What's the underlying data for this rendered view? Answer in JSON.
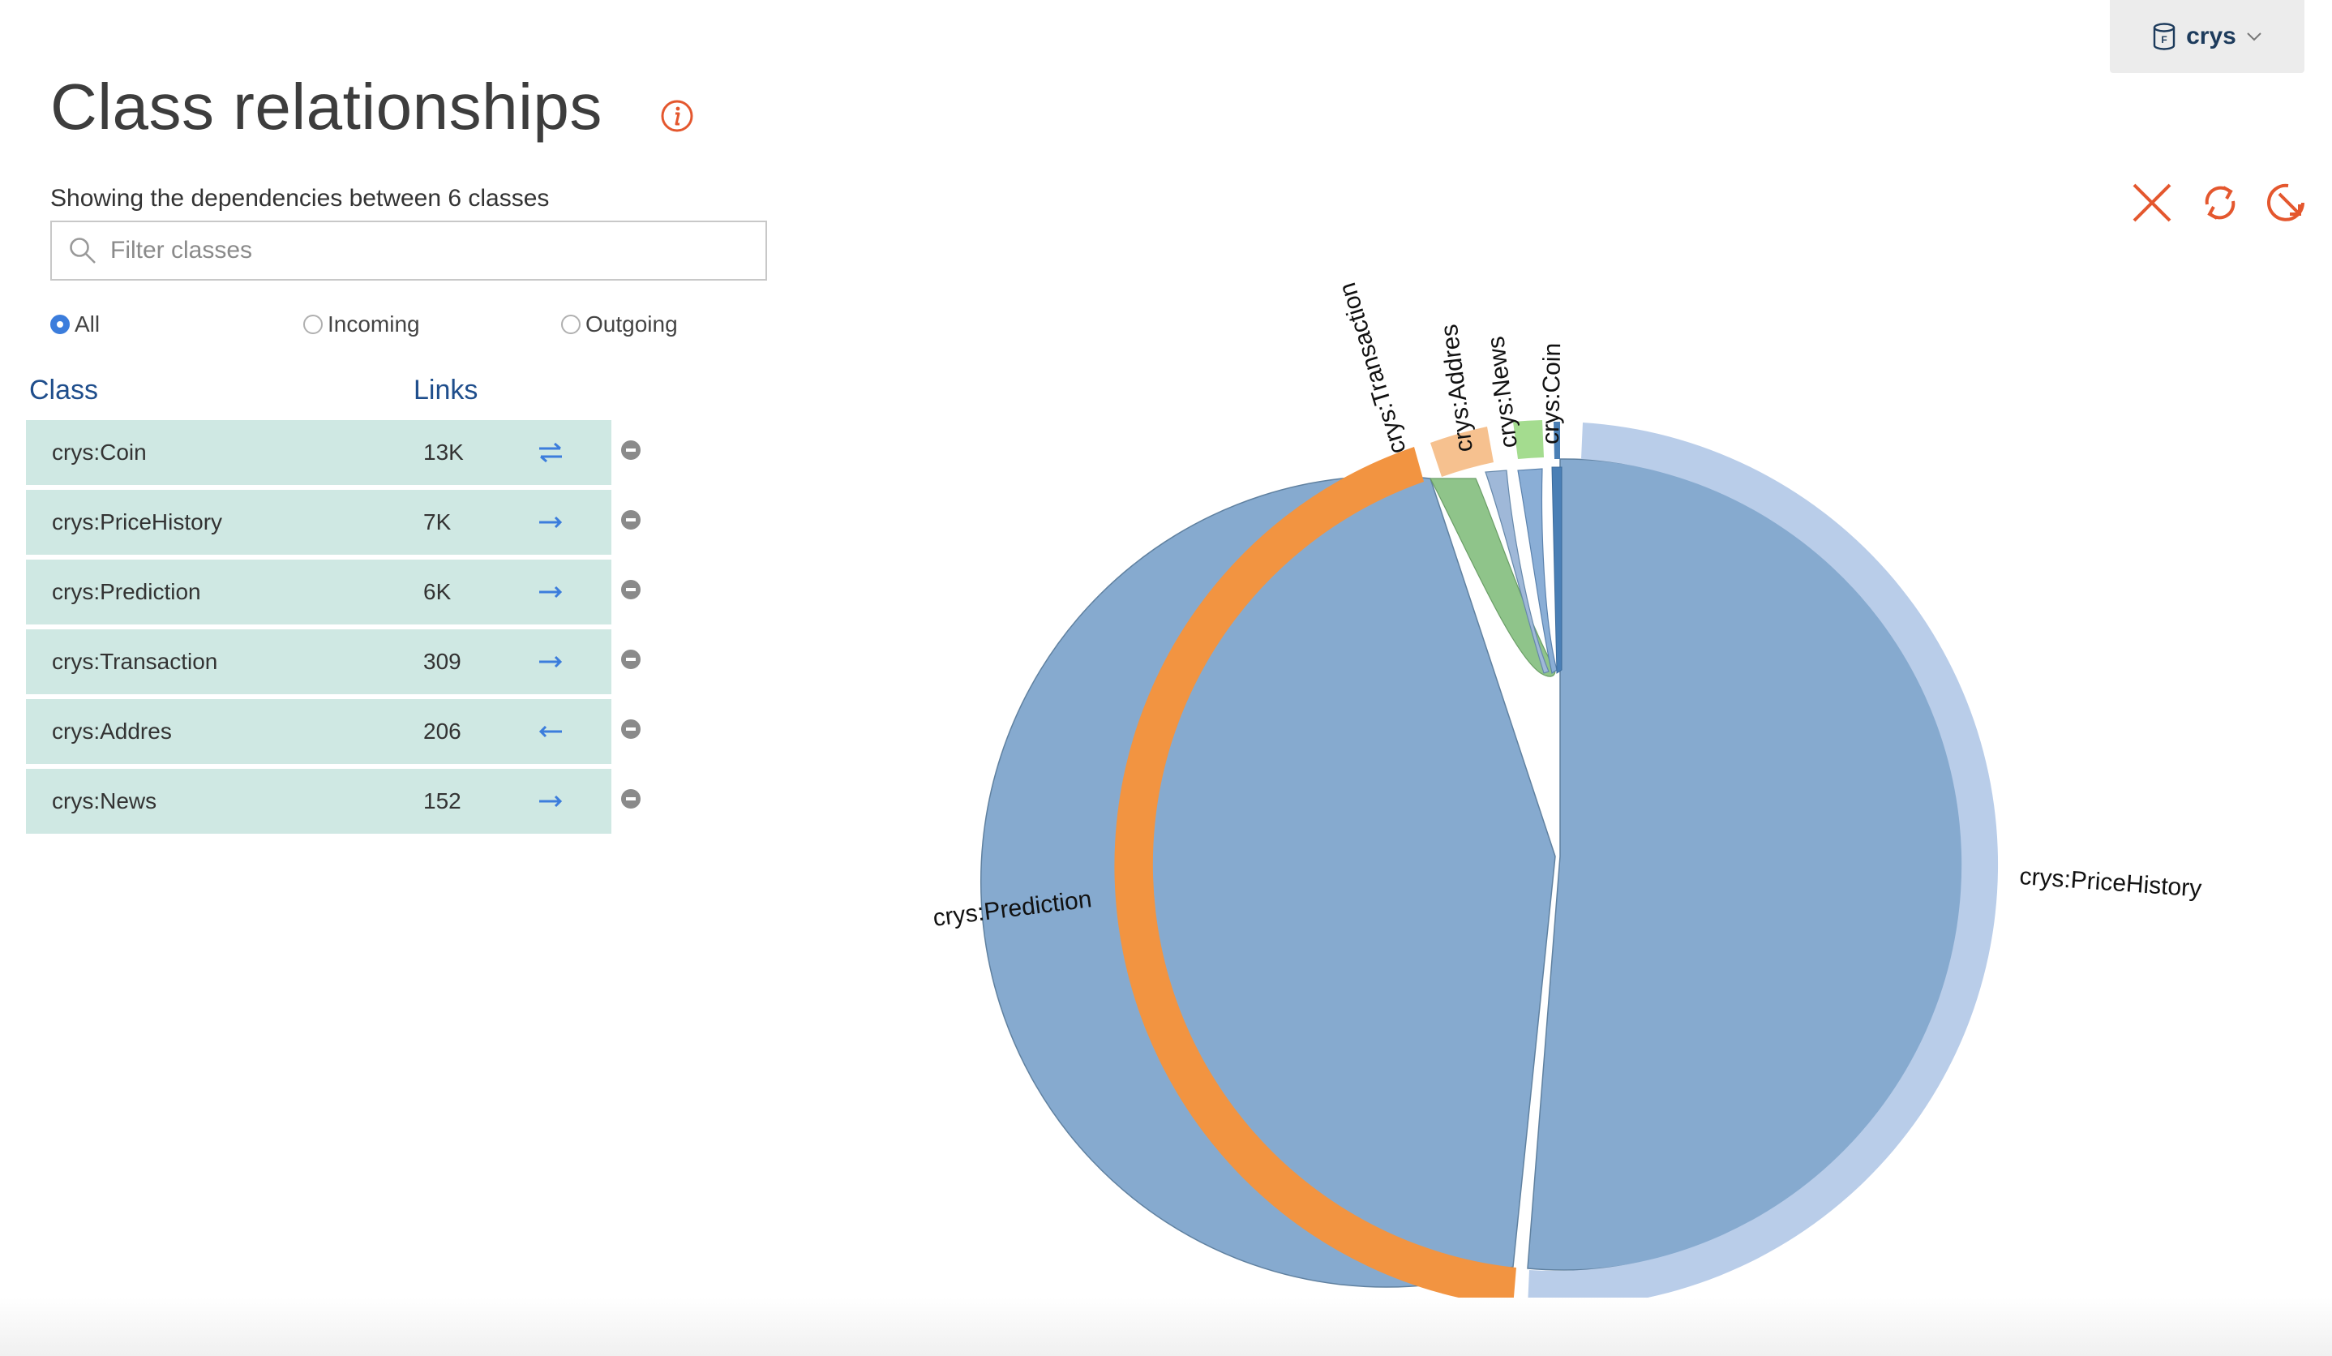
{
  "repository": {
    "name": "crys"
  },
  "header": {
    "title": "Class relationships"
  },
  "summary": "Showing the dependencies between 6 classes",
  "filter": {
    "placeholder": "Filter classes",
    "value": ""
  },
  "direction_options": [
    {
      "label": "All",
      "selected": true
    },
    {
      "label": "Incoming",
      "selected": false
    },
    {
      "label": "Outgoing",
      "selected": false
    }
  ],
  "table": {
    "headers": {
      "class": "Class",
      "links": "Links"
    },
    "rows": [
      {
        "class": "crys:Coin",
        "links": "13K",
        "direction": "both"
      },
      {
        "class": "crys:PriceHistory",
        "links": "7K",
        "direction": "outgoing"
      },
      {
        "class": "crys:Prediction",
        "links": "6K",
        "direction": "outgoing"
      },
      {
        "class": "crys:Transaction",
        "links": "309",
        "direction": "outgoing"
      },
      {
        "class": "crys:Addres",
        "links": "206",
        "direction": "incoming"
      },
      {
        "class": "crys:News",
        "links": "152",
        "direction": "outgoing"
      }
    ]
  },
  "toolbar": [
    "close-icon",
    "refresh-icon",
    "zoom-reset-icon"
  ],
  "colors": {
    "accent": "#e4572e",
    "row_bg": "#cfe8e3",
    "link": "#3c7ddc",
    "ribbon": "#84a9cf"
  },
  "diagram": {
    "type": "chord",
    "groups": [
      {
        "label": "crys:Coin",
        "color": "#4a7fb5",
        "value": 13000
      },
      {
        "label": "crys:PriceHistory",
        "color": "#b9cde9",
        "value": 7000
      },
      {
        "label": "crys:Prediction",
        "color": "#f29441",
        "value": 6000
      },
      {
        "label": "crys:Transaction",
        "color": "#f6c18f",
        "value": 309
      },
      {
        "label": "crys:Addres",
        "color": "#ffffff",
        "value": 206
      },
      {
        "label": "crys:News",
        "color": "#a4dc8f",
        "value": 152
      }
    ]
  }
}
